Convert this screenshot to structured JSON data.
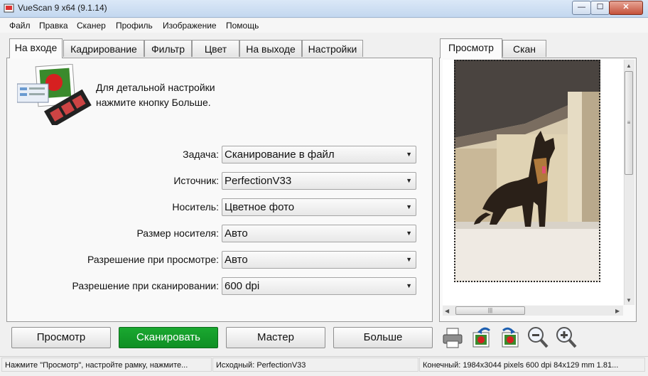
{
  "window": {
    "title": "VueScan 9 x64 (9.1.14)",
    "min": "—",
    "max": "☐",
    "close": "✕"
  },
  "menu": [
    "Файл",
    "Правка",
    "Сканер",
    "Профиль",
    "Изображение",
    "Помощь"
  ],
  "left_tabs": [
    "На входе",
    "Кадрирование",
    "Фильтр",
    "Цвет",
    "На выходе",
    "Настройки"
  ],
  "right_tabs": [
    "Просмотр",
    "Скан"
  ],
  "hint": {
    "line1": "Для детальной настройки",
    "line2": "нажмите кнопку Больше."
  },
  "fields": [
    {
      "label": "Задача:",
      "value": "Сканирование в файл"
    },
    {
      "label": "Источник:",
      "value": "PerfectionV33"
    },
    {
      "label": "Носитель:",
      "value": "Цветное фото"
    },
    {
      "label": "Размер носителя:",
      "value": "Авто"
    },
    {
      "label": "Разрешение при просмотре:",
      "value": "Авто"
    },
    {
      "label": "Разрешение при сканировании:",
      "value": "600 dpi"
    }
  ],
  "buttons": {
    "preview": "Просмотр",
    "scan": "Сканировать",
    "wizard": "Мастер",
    "more": "Больше"
  },
  "tools": [
    "printer-icon",
    "rotate-left-icon",
    "rotate-right-icon",
    "zoom-out-icon",
    "zoom-in-icon"
  ],
  "status": {
    "left": "Нажмите \"Просмотр\", настройте рамку, нажмите...",
    "middle": "Исходный: PerfectionV33",
    "right": "Конечный: 1984x3044 pixels 600 dpi 84x129 mm 1.81..."
  },
  "colors": {
    "scan_button": "#13a02a",
    "titlebar": "#c9dbf1"
  }
}
